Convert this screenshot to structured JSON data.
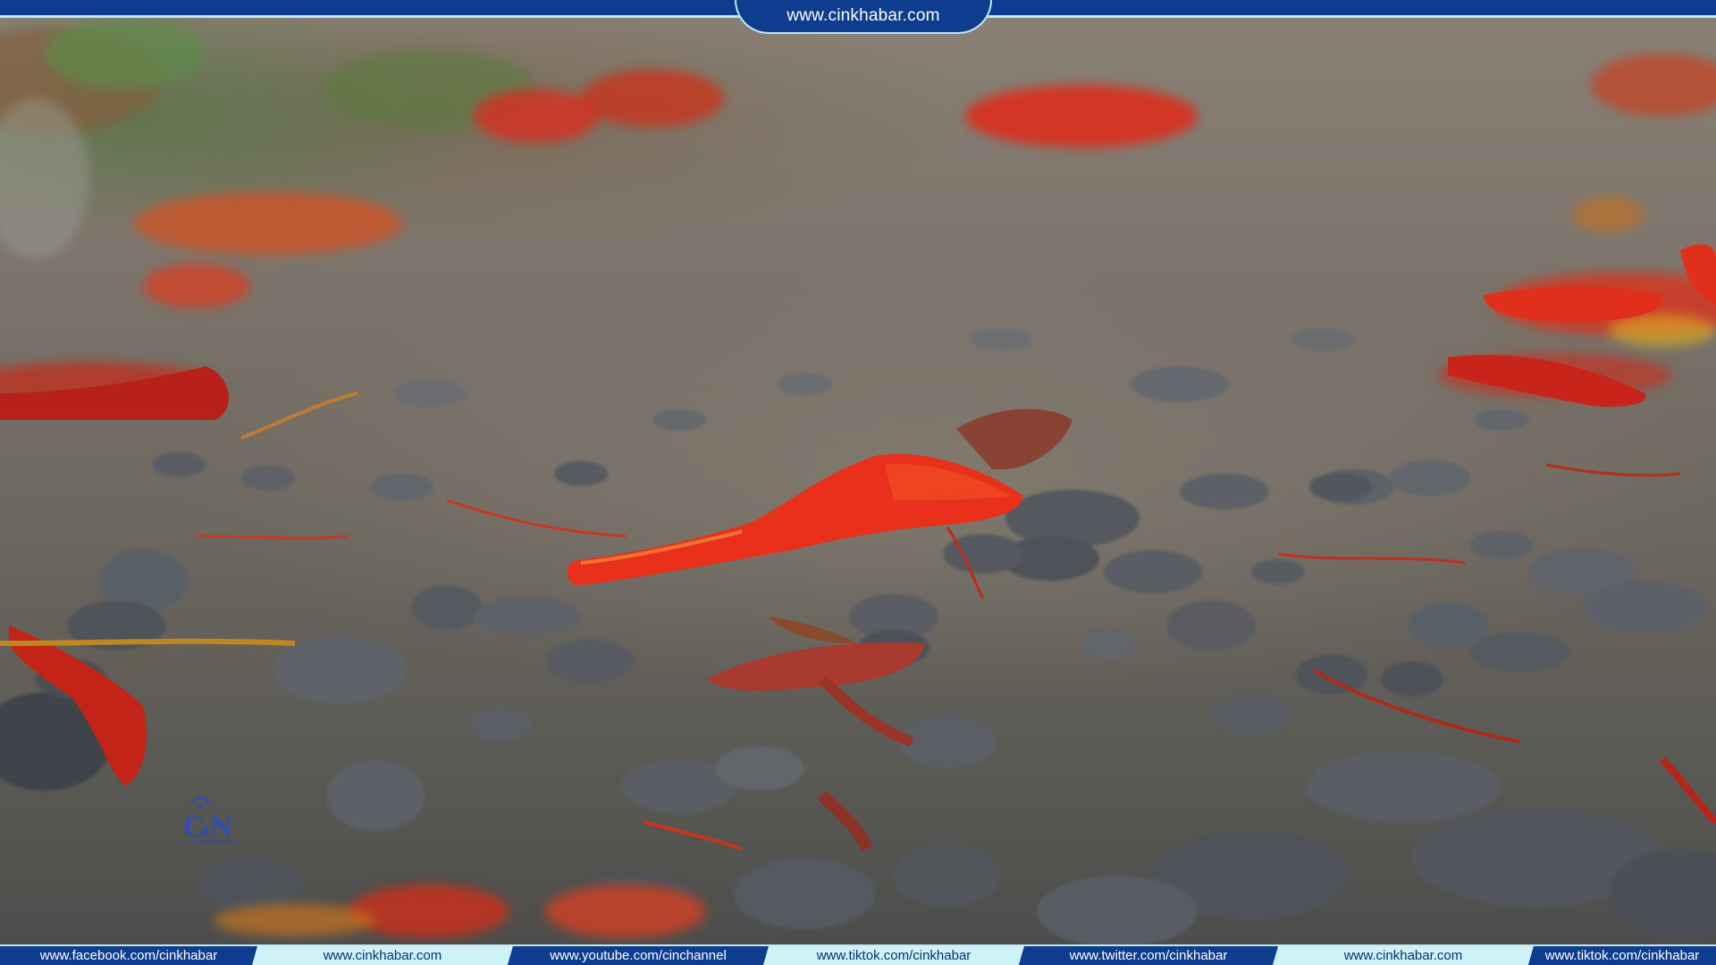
{
  "header": {
    "site_url": "www.cinkhabar.com"
  },
  "watermark": {
    "logo_icon": "cin-logo-icon",
    "logo_text": "CIN"
  },
  "footer": {
    "links": [
      {
        "label": "www.facebook.com/cinkhabar",
        "style": "dark"
      },
      {
        "label": "www.cinkhabar.com",
        "style": "light"
      },
      {
        "label": "www.youtube.com/cinchannel",
        "style": "dark"
      },
      {
        "label": "www.tiktok.com/cinkhabar",
        "style": "light"
      },
      {
        "label": "www.twitter.com/cinkhabar",
        "style": "dark"
      },
      {
        "label": "www.cinkhabar.com",
        "style": "light"
      },
      {
        "label": "www.tiktok.com/cinkhabar",
        "style": "dark"
      }
    ]
  },
  "colors": {
    "banner_blue": "#0e3d8f",
    "banner_accent": "#bfe8f2",
    "petal_red": "#e8301a"
  }
}
